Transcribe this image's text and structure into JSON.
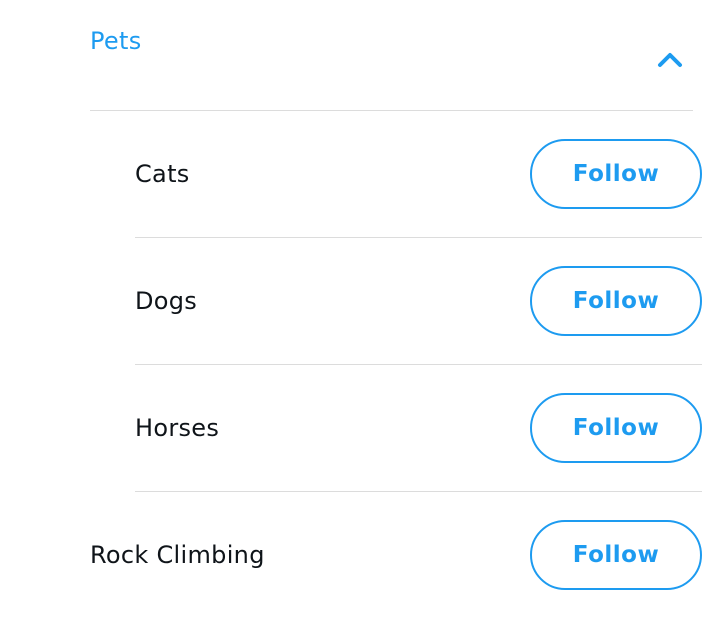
{
  "category": {
    "title": "Pets",
    "expanded": true,
    "icon": "chevron-up-icon"
  },
  "subtopics": [
    {
      "label": "Cats",
      "button": "Follow"
    },
    {
      "label": "Dogs",
      "button": "Follow"
    },
    {
      "label": "Horses",
      "button": "Follow"
    }
  ],
  "next_topic": {
    "label": "Rock Climbing",
    "button": "Follow"
  },
  "colors": {
    "accent": "#1d9bf0",
    "text": "#0f1419",
    "divider": "#dcdcdc"
  }
}
